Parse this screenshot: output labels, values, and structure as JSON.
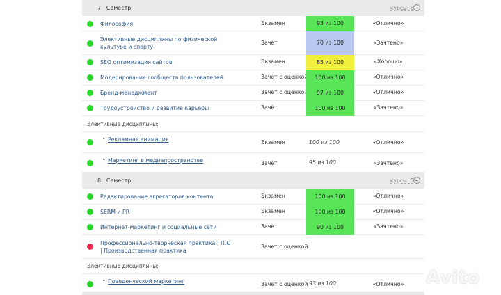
{
  "colors": {
    "green": "#2bd52b",
    "red": "#e8284e",
    "score_green": "#58e658",
    "score_blue": "#b9c8ee",
    "score_yellow": "#f2ee3e",
    "link": "#2d5a8c"
  },
  "semester7": {
    "number": "7",
    "label": "Семестр",
    "courses": "курсы: 8",
    "rows": [
      {
        "name": "Философия",
        "type": "Экзамен",
        "score": "93 из 100",
        "grade": "«Отлично»",
        "status": "green"
      },
      {
        "name": "Элективные дисциплины по физической культуре и спорту",
        "type": "Зачёт",
        "score": "70 из 100",
        "grade": "«Зачтено»",
        "status": "green"
      },
      {
        "name": "SEO оптимизация сайтов",
        "type": "Экзамен",
        "score": "85 из 100",
        "grade": "«Хорошо»",
        "status": "green"
      },
      {
        "name": "Модерирование сообществ пользователей",
        "type": "Зачет с оценкой",
        "score": "100 из 100",
        "grade": "«Отлично»",
        "status": "green"
      },
      {
        "name": "Бренд-менеджмент",
        "type": "Зачет с оценкой",
        "score": "97 из 100",
        "grade": "«Отлично»",
        "status": "green"
      },
      {
        "name": "Трудоустройство и развитие карьеры",
        "type": "Зачёт",
        "score": "100 из 100",
        "grade": "«Зачтено»",
        "status": "green"
      }
    ],
    "electives_label": "Элективные дисциплины:",
    "electives": [
      {
        "bullet": "•",
        "name": "Рекламная анимация",
        "type": "Экзамен",
        "score": "100 из 100",
        "grade": "«Отлично»",
        "status": "green"
      },
      {
        "bullet": "•",
        "name": "Маркетинг в медиапространстве",
        "type": "Зачёт",
        "score": "95 из 100",
        "grade": "«Зачтено»",
        "status": "green"
      }
    ]
  },
  "semester8": {
    "number": "8",
    "label": "Семестр",
    "courses": "курсы: 5",
    "rows": [
      {
        "name": "Редактирование агрегаторов контента",
        "type": "Экзамен",
        "score": "100 из 100",
        "grade": "«Отлично»",
        "status": "green"
      },
      {
        "name": "SERM и PR",
        "type": "Экзамен",
        "score": "100 из 100",
        "grade": "«Отлично»",
        "status": "green"
      },
      {
        "name": "Интернет-маркетинг и социальные сети",
        "type": "Зачёт",
        "score": "90 из 100",
        "grade": "«Зачтено»",
        "status": "green"
      },
      {
        "name": "Профессионально-творческая практика | П.О | Производственная практика",
        "type": "Зачет с оценкой",
        "score": "",
        "grade": "",
        "status": "red"
      }
    ],
    "electives_label": "Элективные дисциплины:",
    "electives": [
      {
        "bullet": "•",
        "name": "Поведенческий маркетинг",
        "type": "Зачет с оценкой",
        "score": "93 из 100",
        "grade": "«Отлично»",
        "status": "green"
      }
    ]
  },
  "watermark": "Avito"
}
